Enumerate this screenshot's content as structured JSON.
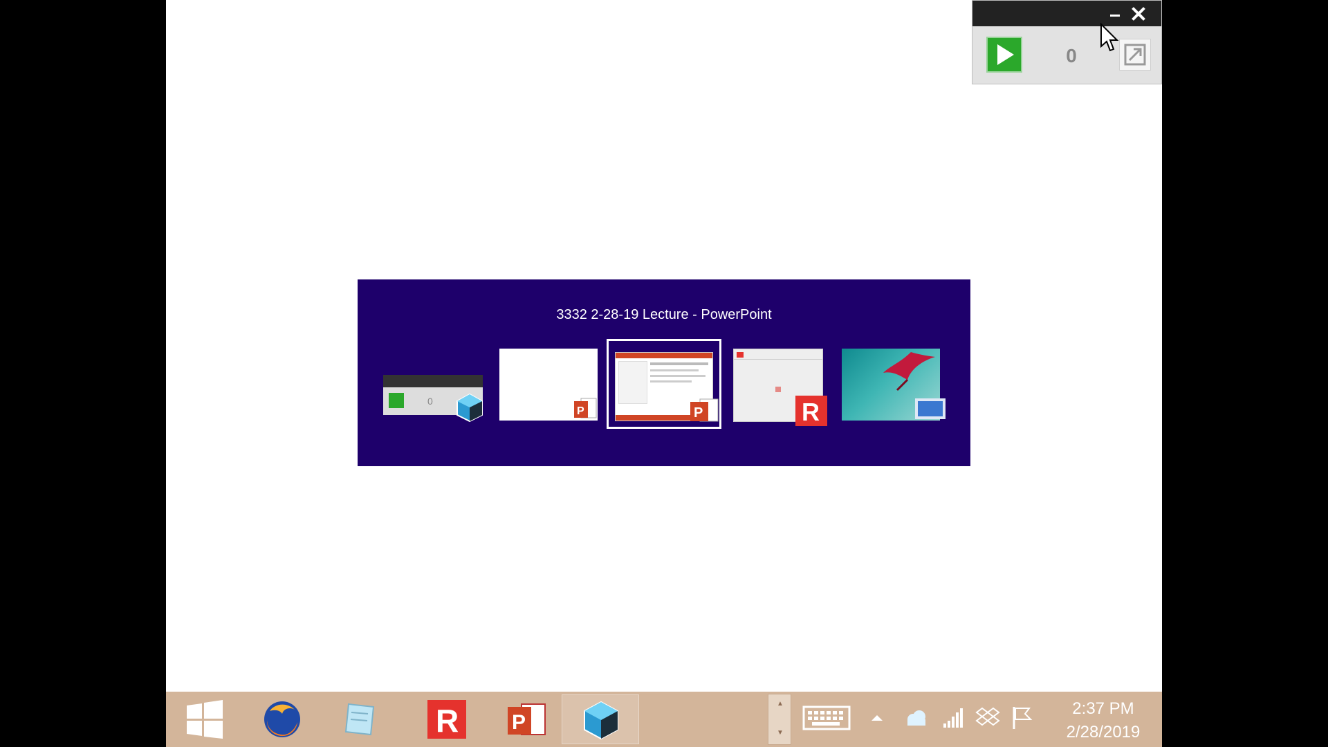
{
  "switcher": {
    "title": "3332 2-28-19 Lecture - PowerPoint",
    "widget_thumb_count": "0"
  },
  "widget": {
    "count": "0",
    "icons": [
      "minimize-icon",
      "close-icon",
      "play-icon",
      "expand-icon"
    ]
  },
  "taskbar": {
    "time": "2:37 PM",
    "date": "2/28/2019",
    "apps": [
      "start",
      "firefox",
      "notepad",
      "r-app",
      "powerpoint",
      "cube-app"
    ],
    "tray": [
      "keyboard-icon",
      "chevron-up-icon",
      "cloud-icon",
      "signal-icon",
      "dropbox-icon",
      "flag-icon"
    ]
  },
  "colors": {
    "switcher_bg": "#1e006b",
    "taskbar_bg": "#d3b59a",
    "widget_play": "#2ba82b",
    "powerpoint": "#d04525",
    "r_app": "#e5322d"
  }
}
